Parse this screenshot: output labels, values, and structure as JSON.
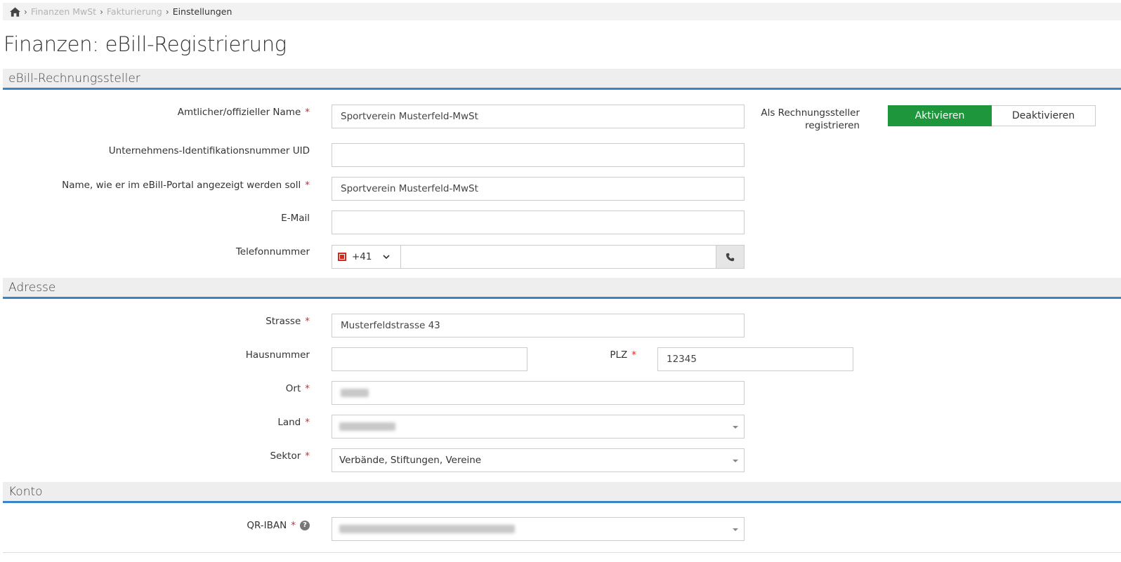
{
  "breadcrumb": {
    "items": [
      "Finanzen MwSt",
      "Fakturierung"
    ],
    "current": "Einstellungen"
  },
  "page_title": "Finanzen: eBill-Registrierung",
  "sections": {
    "rechnungssteller": "eBill-Rechnungssteller",
    "adresse": "Adresse",
    "konto": "Konto"
  },
  "fields": {
    "amtlicher_name": {
      "label": "Amtlicher/offizieller Name",
      "value": "Sportverein Musterfeld-MwSt"
    },
    "uid": {
      "label": "Unternehmens-Identifikationsnummer UID",
      "value": ""
    },
    "portal_name": {
      "label": "Name, wie er im eBill-Portal angezeigt werden soll",
      "value": "Sportverein Musterfeld-MwSt"
    },
    "email": {
      "label": "E-Mail",
      "value": ""
    },
    "telefon": {
      "label": "Telefonnummer",
      "country_code": "+41",
      "value": ""
    },
    "strasse": {
      "label": "Strasse",
      "value": "Musterfeldstrasse 43"
    },
    "hausnummer": {
      "label": "Hausnummer",
      "value": ""
    },
    "plz": {
      "label": "PLZ",
      "value": "12345"
    },
    "ort": {
      "label": "Ort"
    },
    "land": {
      "label": "Land"
    },
    "sektor": {
      "label": "Sektor",
      "value": "Verbände, Stiftungen, Vereine"
    },
    "qr_iban": {
      "label": "QR-IBAN"
    }
  },
  "required_marker": "*",
  "registration": {
    "label_line1": "Als Rechnungssteller",
    "label_line2": "registrieren",
    "activate": "Aktivieren",
    "deactivate": "Deaktivieren",
    "active": "activate"
  },
  "colors": {
    "accent": "#3a85c7",
    "active_green": "#1e963c",
    "required_red": "#d9272e"
  }
}
